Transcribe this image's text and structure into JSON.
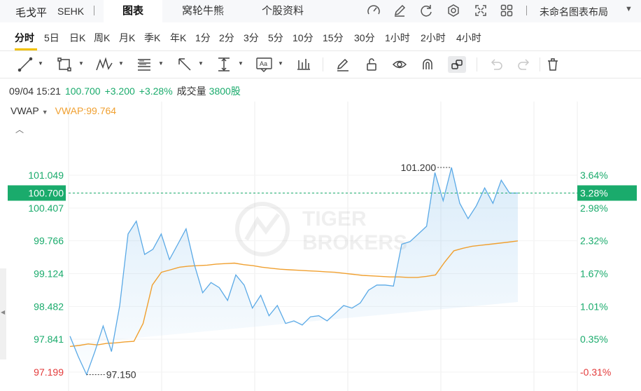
{
  "header": {
    "stock_name": "毛戈平",
    "exchange": "SEHK",
    "tabs": [
      "图表",
      "窝轮牛熊",
      "个股资料"
    ],
    "active_tab": "图表",
    "layout_name": "未命名图表布局",
    "icons": [
      "indicator-icon",
      "draw-icon",
      "refresh-icon",
      "settings-icon",
      "fullscreen-icon",
      "grid-layout-icon"
    ]
  },
  "periods": [
    "分时",
    "5日",
    "日K",
    "周K",
    "月K",
    "季K",
    "年K",
    "1分",
    "2分",
    "3分",
    "5分",
    "10分",
    "15分",
    "30分",
    "1小时",
    "2小时",
    "4小时"
  ],
  "active_period": "分时",
  "toolbar": {
    "tools": [
      "line-tool-icon",
      "rectangle-tool-icon",
      "pattern-tool-icon",
      "fibonacci-tool-icon",
      "arrow-tool-icon",
      "measure-tool-icon",
      "text-note-tool-icon",
      "bar-style-icon",
      "pen-icon",
      "lock-icon",
      "eye-icon",
      "magnet-icon",
      "link-icon",
      "undo-icon",
      "redo-icon",
      "trash-icon"
    ]
  },
  "info": {
    "datetime": "09/04 15:21",
    "price": "100.700",
    "change": "+3.200",
    "change_pct": "+3.28%",
    "volume_label": "成交量",
    "volume": "3800股"
  },
  "indicator": {
    "name": "VWAP",
    "value_text": "VWAP:99.764"
  },
  "colors": {
    "up": "#1aab6c",
    "down": "#e33b3b",
    "price_line": "#5aa9e6",
    "vwap_line": "#f0a030",
    "current_tag": "#1aab6c"
  },
  "chart_data": {
    "type": "area",
    "series": [
      {
        "name": "VWAP",
        "values": [
          97.7,
          97.72,
          97.75,
          97.73,
          97.76,
          97.77,
          97.79,
          97.8,
          98.15,
          98.9,
          99.15,
          99.2,
          99.25,
          99.27,
          99.28,
          99.29,
          99.31,
          99.32,
          99.33,
          99.3,
          99.28,
          99.25,
          99.23,
          99.21,
          99.2,
          99.19,
          99.18,
          99.17,
          99.16,
          99.15,
          99.13,
          99.11,
          99.09,
          99.08,
          99.07,
          99.06,
          99.06,
          99.05,
          99.05,
          99.07,
          99.1,
          99.35,
          99.57,
          99.62,
          99.66,
          99.68,
          99.7,
          99.72,
          99.74,
          99.764
        ]
      },
      {
        "name": "price",
        "values": [
          97.9,
          97.5,
          97.15,
          97.6,
          98.1,
          97.6,
          98.5,
          99.9,
          100.15,
          99.5,
          99.6,
          99.9,
          99.4,
          99.7,
          100.0,
          99.3,
          98.75,
          98.95,
          98.85,
          98.6,
          99.1,
          98.9,
          98.45,
          98.7,
          98.3,
          98.5,
          98.15,
          98.2,
          98.12,
          98.28,
          98.3,
          98.2,
          98.35,
          98.5,
          98.45,
          98.55,
          98.8,
          98.9,
          98.9,
          98.88,
          99.7,
          99.75,
          99.9,
          100.05,
          101.1,
          100.55,
          101.2,
          100.5,
          100.2,
          100.45,
          100.8,
          100.5,
          100.95,
          100.7,
          100.7
        ]
      }
    ],
    "annotations": {
      "high": "101.200",
      "low": "97.150"
    },
    "current_price": "100.700",
    "current_pct": "3.28%",
    "y_labels": [
      "101.049",
      "100.700",
      "100.407",
      "99.766",
      "99.124",
      "98.482",
      "97.841",
      "97.199"
    ],
    "pct_labels": [
      "3.64%",
      "3.28%",
      "2.98%",
      "2.32%",
      "1.67%",
      "1.01%",
      "0.35%",
      "-0.31%"
    ],
    "ylim": [
      97.199,
      101.049
    ]
  },
  "watermark": "TIGER BROKERS"
}
